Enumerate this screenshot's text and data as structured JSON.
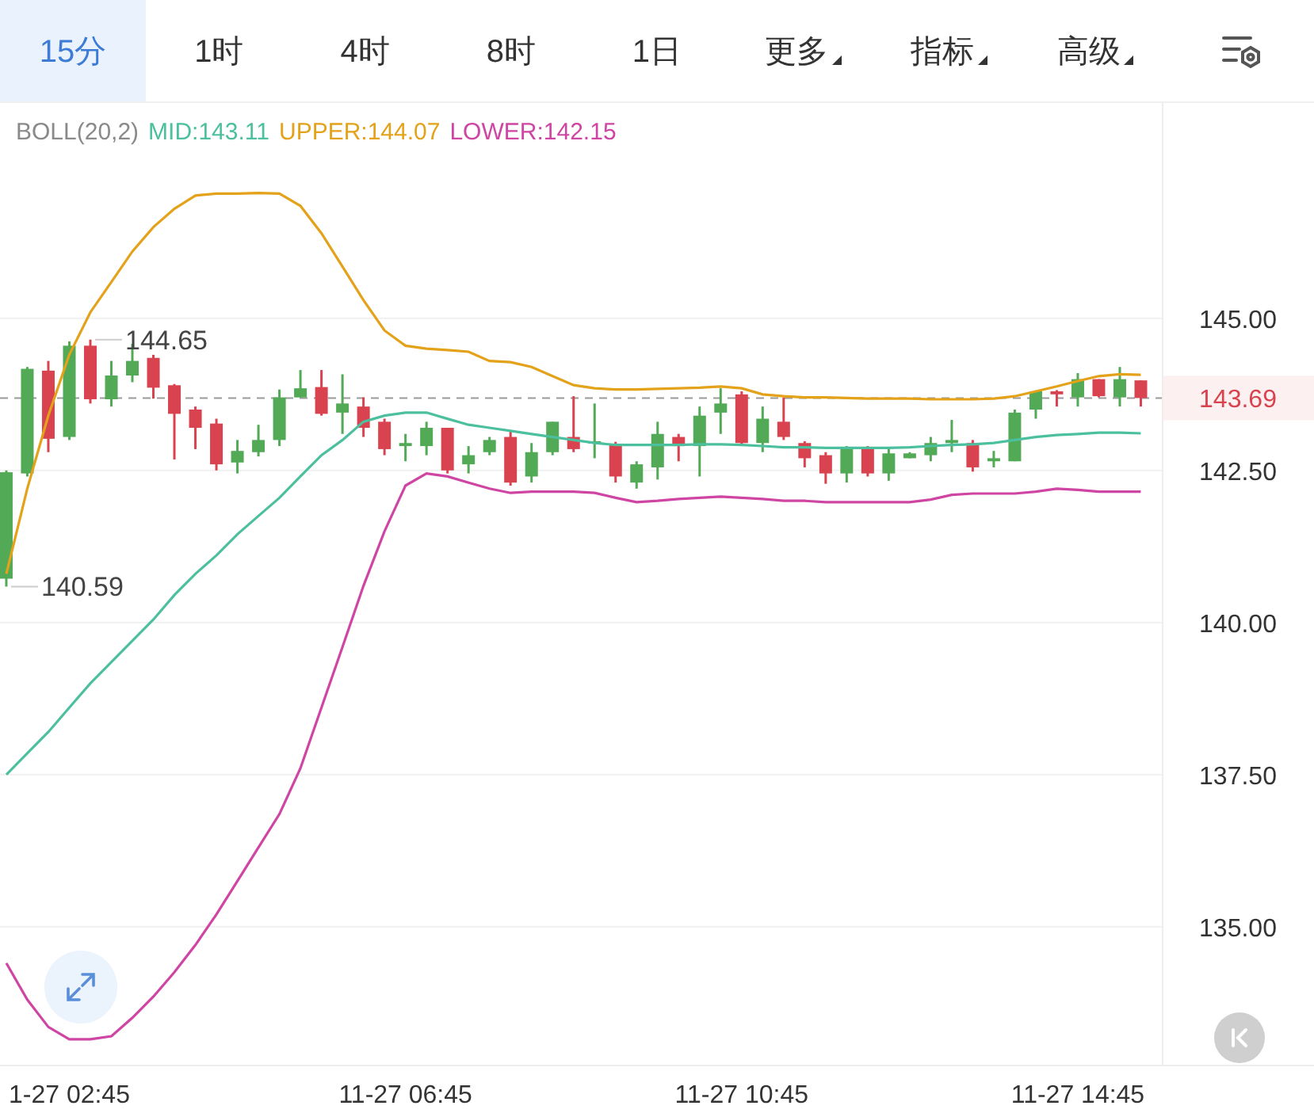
{
  "tabs": [
    {
      "label": "15分",
      "selected": true,
      "menu": false
    },
    {
      "label": "1时",
      "selected": false,
      "menu": false
    },
    {
      "label": "4时",
      "selected": false,
      "menu": false
    },
    {
      "label": "8时",
      "selected": false,
      "menu": false
    },
    {
      "label": "1日",
      "selected": false,
      "menu": false
    },
    {
      "label": "更多",
      "selected": false,
      "menu": true
    },
    {
      "label": "指标",
      "selected": false,
      "menu": true
    },
    {
      "label": "高级",
      "selected": false,
      "menu": true
    }
  ],
  "chart": {
    "indicator": "BOLL(20,2)",
    "legend_values": [
      ":143.11",
      ":144.07",
      ":142.15"
    ],
    "chart_data": {
      "type": "candlestick",
      "grid": true,
      "ylim": [
        132.73,
        148.54
      ],
      "categories": [
        null,
        null,
        null,
        "1-27 02:45",
        null,
        null,
        null,
        null,
        null,
        null,
        null,
        null,
        null,
        null,
        null,
        null,
        null,
        null,
        null,
        "11-27 06:45",
        null,
        null,
        null,
        null,
        null,
        null,
        null,
        null,
        null,
        null,
        null,
        null,
        null,
        null,
        null,
        "11-27 10:45",
        null,
        null,
        null,
        null,
        null,
        null,
        null,
        null,
        null,
        null,
        null,
        null,
        null,
        null,
        null,
        "11-27 14:45",
        null,
        null,
        null
      ],
      "ohlc": [
        [
          140.72,
          142.5,
          140.59,
          142.47
        ],
        [
          142.45,
          144.2,
          142.4,
          144.17
        ],
        [
          144.14,
          144.3,
          142.8,
          143.02
        ],
        [
          143.05,
          144.62,
          143.0,
          144.55
        ],
        [
          144.55,
          144.65,
          143.6,
          143.67
        ],
        [
          143.67,
          144.3,
          143.55,
          144.06
        ],
        [
          144.06,
          144.58,
          143.95,
          144.3
        ],
        [
          144.35,
          144.4,
          143.68,
          143.86
        ],
        [
          143.9,
          143.92,
          142.68,
          143.43
        ],
        [
          143.5,
          143.55,
          142.85,
          143.2
        ],
        [
          143.27,
          143.35,
          142.5,
          142.6
        ],
        [
          142.63,
          143.0,
          142.45,
          142.82
        ],
        [
          142.8,
          143.25,
          142.73,
          143.0
        ],
        [
          143.0,
          143.83,
          142.9,
          143.7
        ],
        [
          143.7,
          144.15,
          143.7,
          143.85
        ],
        [
          143.87,
          144.15,
          143.4,
          143.43
        ],
        [
          143.45,
          144.08,
          143.1,
          143.6
        ],
        [
          143.55,
          143.7,
          143.05,
          143.2
        ],
        [
          143.3,
          143.35,
          142.75,
          142.85
        ],
        [
          142.9,
          143.1,
          142.65,
          142.95
        ],
        [
          142.9,
          143.3,
          142.75,
          143.2
        ],
        [
          143.2,
          143.2,
          142.45,
          142.5
        ],
        [
          142.6,
          142.9,
          142.45,
          142.75
        ],
        [
          142.8,
          143.05,
          142.75,
          143.0
        ],
        [
          143.05,
          143.15,
          142.25,
          142.3
        ],
        [
          142.4,
          142.95,
          142.3,
          142.8
        ],
        [
          142.8,
          143.3,
          142.75,
          143.3
        ],
        [
          143.05,
          143.72,
          142.8,
          142.85
        ],
        [
          142.95,
          143.6,
          142.7,
          142.98
        ],
        [
          142.93,
          142.97,
          142.3,
          142.4
        ],
        [
          142.3,
          142.65,
          142.2,
          142.6
        ],
        [
          142.55,
          143.3,
          142.35,
          143.1
        ],
        [
          143.05,
          143.1,
          142.65,
          142.9
        ],
        [
          142.9,
          143.55,
          142.4,
          143.4
        ],
        [
          143.45,
          143.85,
          143.1,
          143.6
        ],
        [
          143.75,
          143.8,
          142.9,
          142.95
        ],
        [
          142.95,
          143.55,
          142.8,
          143.35
        ],
        [
          143.3,
          143.7,
          143.0,
          143.05
        ],
        [
          142.95,
          142.98,
          142.55,
          142.7
        ],
        [
          142.75,
          142.8,
          142.28,
          142.45
        ],
        [
          142.45,
          142.9,
          142.3,
          142.85
        ],
        [
          142.85,
          142.9,
          142.4,
          142.45
        ],
        [
          142.45,
          142.85,
          142.33,
          142.78
        ],
        [
          142.7,
          142.8,
          142.7,
          142.78
        ],
        [
          142.75,
          143.05,
          142.65,
          142.95
        ],
        [
          142.95,
          143.33,
          142.8,
          143.0
        ],
        [
          142.95,
          143.0,
          142.48,
          142.55
        ],
        [
          142.65,
          142.82,
          142.55,
          142.7
        ],
        [
          142.65,
          143.5,
          142.65,
          143.45
        ],
        [
          143.5,
          143.8,
          143.35,
          143.8
        ],
        [
          143.8,
          143.82,
          143.55,
          143.75
        ],
        [
          143.7,
          144.1,
          143.55,
          144.0
        ],
        [
          144.0,
          144.0,
          143.7,
          143.72
        ],
        [
          143.7,
          144.2,
          143.55,
          144.0
        ],
        [
          143.98,
          143.98,
          143.55,
          143.69
        ]
      ],
      "yticks": [
        {
          "value": 145,
          "label": "145.00"
        },
        {
          "value": 142.5,
          "label": "142.50"
        },
        {
          "value": 140,
          "label": "140.00"
        },
        {
          "value": 137.5,
          "label": "137.50"
        },
        {
          "value": 135,
          "label": "135.00"
        }
      ],
      "series": [
        {
          "name": "MID",
          "type": "line",
          "color": "#4cc09e",
          "values": [
            137.5,
            137.85,
            138.2,
            138.6,
            139.0,
            139.35,
            139.7,
            140.05,
            140.45,
            140.8,
            141.1,
            141.45,
            141.75,
            142.05,
            142.4,
            142.75,
            143.0,
            143.3,
            143.4,
            143.45,
            143.45,
            143.35,
            143.25,
            143.2,
            143.15,
            143.1,
            143.05,
            143.0,
            142.95,
            142.92,
            142.92,
            142.92,
            142.92,
            142.93,
            142.93,
            142.92,
            142.9,
            142.88,
            142.88,
            142.87,
            142.87,
            142.87,
            142.87,
            142.88,
            142.9,
            142.92,
            142.93,
            142.95,
            143.0,
            143.05,
            143.08,
            143.1,
            143.12,
            143.12,
            143.11
          ]
        },
        {
          "name": "UPPER",
          "type": "line",
          "color": "#e3a21a",
          "values": [
            140.8,
            142.2,
            143.4,
            144.4,
            145.1,
            145.6,
            146.1,
            146.5,
            146.8,
            147.02,
            147.05,
            147.05,
            147.06,
            147.05,
            146.85,
            146.4,
            145.85,
            145.3,
            144.8,
            144.55,
            144.5,
            144.48,
            144.45,
            144.3,
            144.28,
            144.2,
            144.05,
            143.9,
            143.85,
            143.83,
            143.83,
            143.84,
            143.85,
            143.86,
            143.88,
            143.85,
            143.75,
            143.72,
            143.7,
            143.7,
            143.69,
            143.68,
            143.68,
            143.68,
            143.67,
            143.67,
            143.67,
            143.68,
            143.72,
            143.8,
            143.88,
            143.97,
            144.05,
            144.08,
            144.07
          ]
        },
        {
          "name": "LOWER",
          "type": "line",
          "color": "#cf45a3",
          "values": [
            134.4,
            133.8,
            133.35,
            133.15,
            133.15,
            133.2,
            133.5,
            133.85,
            134.25,
            134.7,
            135.2,
            135.75,
            136.3,
            136.85,
            137.6,
            138.6,
            139.6,
            140.6,
            141.5,
            142.25,
            142.45,
            142.4,
            142.3,
            142.2,
            142.13,
            142.15,
            142.15,
            142.15,
            142.13,
            142.05,
            141.98,
            142.0,
            142.03,
            142.05,
            142.07,
            142.05,
            142.03,
            142.0,
            142.0,
            141.98,
            141.98,
            141.98,
            141.98,
            141.98,
            142.02,
            142.1,
            142.12,
            142.12,
            142.12,
            142.15,
            142.2,
            142.18,
            142.15,
            142.15,
            142.15
          ]
        }
      ],
      "annotations": [
        "144.65",
        "140.59"
      ],
      "ref_lines": [
        {
          "axis": "y",
          "value": 143.69,
          "label": "143.69"
        }
      ]
    }
  }
}
